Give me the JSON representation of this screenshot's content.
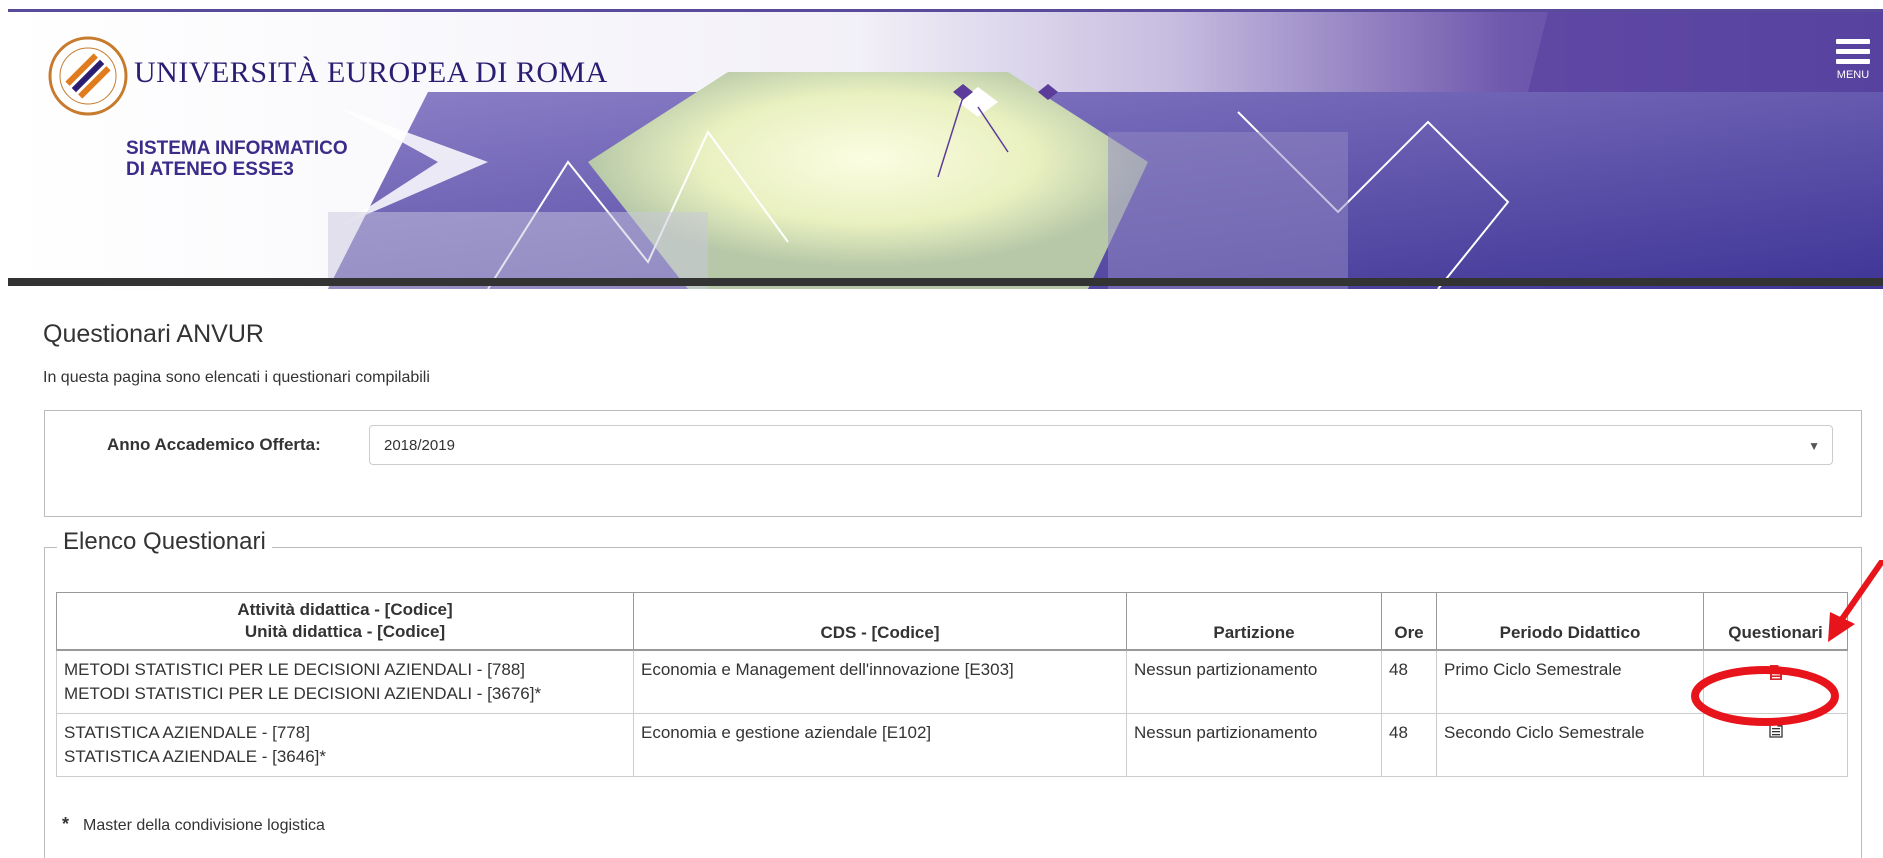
{
  "header": {
    "university_name": "UNIVERSITÀ EUROPEA DI ROMA",
    "system_title_line1": "SISTEMA INFORMATICO",
    "system_title_line2": "DI ATENEO ESSE3",
    "menu_label": "MENU"
  },
  "page": {
    "title": "Questionari ANVUR",
    "description": "In questa pagina sono elencati i questionari compilabili"
  },
  "filter": {
    "label": "Anno Accademico Offerta:",
    "selected_value": "2018/2019"
  },
  "list": {
    "legend": "Elenco Questionari",
    "columns": [
      {
        "line1": "Attività didattica - [Codice]",
        "line2": "Unità didattica - [Codice]"
      },
      {
        "line1": "CDS - [Codice]"
      },
      {
        "line1": "Partizione"
      },
      {
        "line1": "Ore"
      },
      {
        "line1": "Periodo Didattico"
      },
      {
        "line1": "Questionari"
      }
    ],
    "rows": [
      {
        "attivita": "METODI STATISTICI PER LE DECISIONI AZIENDALI - [788]",
        "unita": "METODI STATISTICI PER LE DECISIONI AZIENDALI - [3676]*",
        "cds": "Economia e Management dell'innovazione [E303]",
        "partizione": "Nessun partizionamento",
        "ore": "48",
        "periodo": "Primo Ciclo Semestrale",
        "questionario_icon": "document-red-icon",
        "icon_color": "#d9262c"
      },
      {
        "attivita": "STATISTICA AZIENDALE - [778]",
        "unita": "STATISTICA AZIENDALE - [3646]*",
        "cds": "Economia e gestione aziendale [E102]",
        "partizione": "Nessun partizionamento",
        "ore": "48",
        "periodo": "Secondo Ciclo Semestrale",
        "questionario_icon": "document-icon",
        "icon_color": "#333333"
      }
    ],
    "footnote_mark": "*",
    "footnote": "Master della condivisione logistica"
  },
  "annotation": {
    "color": "#e8141c"
  }
}
